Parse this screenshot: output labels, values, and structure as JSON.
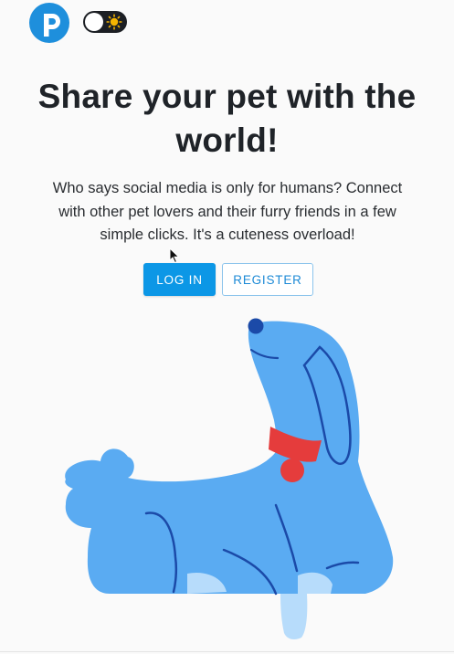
{
  "header": {
    "logo_letter": "p",
    "theme_toggle_state": "light",
    "colors": {
      "brand": "#1e8fdc",
      "toggle_track": "#1c1f24",
      "sun": "#f5b400"
    }
  },
  "hero": {
    "title": "Share your pet with the world!",
    "description": "Who says social media is only for humans? Connect with other pet lovers and their furry friends in a few simple clicks. It's a cuteness overload!"
  },
  "actions": {
    "login_label": "LOG IN",
    "register_label": "REGISTER"
  },
  "illustration": {
    "subject": "dog-illustration",
    "colors": {
      "body": "#5aabf2",
      "collar": "#e53c3c",
      "lines": "#1b4aa8",
      "paws": "#b7dcfb"
    }
  }
}
